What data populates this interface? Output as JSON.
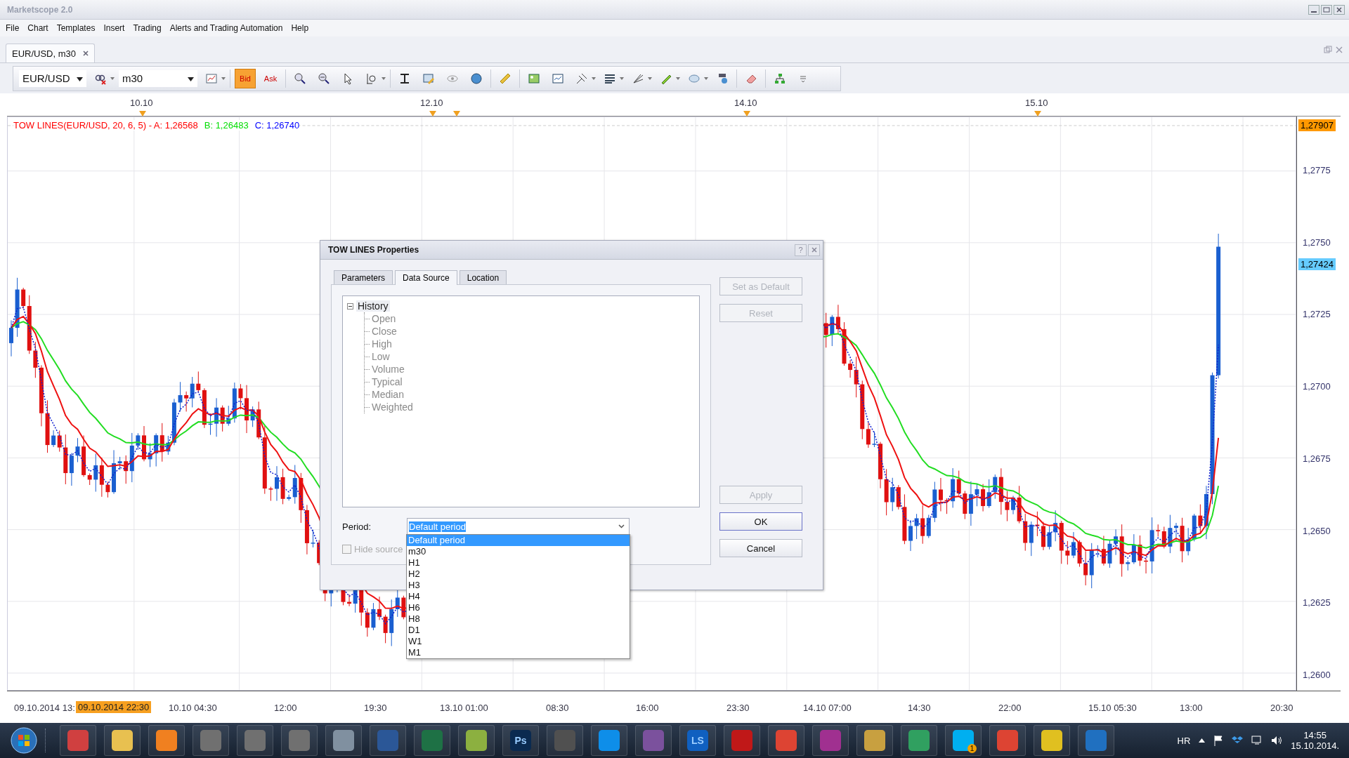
{
  "window": {
    "title": "Marketscope 2.0"
  },
  "menu": [
    "File",
    "Chart",
    "Templates",
    "Insert",
    "Trading",
    "Alerts and Trading Automation",
    "Help"
  ],
  "tabs": [
    {
      "label": "EUR/USD, m30",
      "selected": true
    }
  ],
  "toolbar": {
    "instrument": "EUR/USD",
    "timeframe": "m30",
    "price_modes": [
      {
        "label": "Bid",
        "selected": true
      },
      {
        "label": "Ask",
        "selected": false
      }
    ]
  },
  "chart": {
    "date_labels": [
      "10.10",
      "12.10",
      "14.10",
      "15.10"
    ],
    "legend": [
      {
        "text": "TOW LINES(EUR/USD, 20, 6, 5) -  A: 1,26568",
        "color": "#ff0000"
      },
      {
        "text": "B: 1,26483",
        "color": "#00dd00"
      },
      {
        "text": "C: 1,26740",
        "color": "#0000ff"
      }
    ],
    "price_labels": [
      "1,2775",
      "1,2750",
      "1,2725",
      "1,2700",
      "1,2675",
      "1,2650",
      "1,2625",
      "1,2600"
    ],
    "price_markers": [
      {
        "text": "1,27907",
        "color": "#ff9900"
      },
      {
        "text": "1,27424",
        "color": "#66ccff"
      }
    ],
    "time_labels": [
      "09.10.2014 13:",
      "10.10 04:30",
      "12:00",
      "19:30",
      "13.10 01:00",
      "08:30",
      "16:00",
      "23:30",
      "14.10 07:00",
      "14:30",
      "22:00",
      "15.10 05:30",
      "13:00",
      "20:30"
    ],
    "cursor_time": "09.10.2014 22:30"
  },
  "dialog": {
    "title": "TOW LINES Properties",
    "help": "?",
    "tabs": [
      {
        "label": "Parameters",
        "selected": false
      },
      {
        "label": "Data Source",
        "selected": true
      },
      {
        "label": "Location",
        "selected": false
      }
    ],
    "tree": [
      {
        "label": "History",
        "expanded": true,
        "disabled": false,
        "children": [
          {
            "label": "Open",
            "disabled": true
          },
          {
            "label": "Close",
            "disabled": true
          },
          {
            "label": "High",
            "disabled": true
          },
          {
            "label": "Low",
            "disabled": true
          },
          {
            "label": "Volume",
            "disabled": true
          },
          {
            "label": "Typical",
            "disabled": true
          },
          {
            "label": "Median",
            "disabled": true
          },
          {
            "label": "Weighted",
            "disabled": true
          }
        ]
      }
    ],
    "period": {
      "label": "Period:",
      "value": "Default period",
      "expanded": true,
      "options": [
        {
          "label": "Default period",
          "selected": true
        },
        {
          "label": "m30",
          "selected": false
        },
        {
          "label": "H1",
          "selected": false
        },
        {
          "label": "H2",
          "selected": false
        },
        {
          "label": "H3",
          "selected": false
        },
        {
          "label": "H4",
          "selected": false
        },
        {
          "label": "H6",
          "selected": false
        },
        {
          "label": "H8",
          "selected": false
        },
        {
          "label": "D1",
          "selected": false
        },
        {
          "label": "W1",
          "selected": false
        },
        {
          "label": "M1",
          "selected": false
        }
      ]
    },
    "hide_source": {
      "label": "Hide source",
      "checked": false,
      "disabled": true
    },
    "side_buttons": [
      {
        "label": "Set as Default",
        "disabled": true,
        "focused": false
      },
      {
        "label": "Reset",
        "disabled": true,
        "focused": false
      }
    ],
    "action_buttons": [
      {
        "label": "Apply",
        "disabled": true,
        "focused": false
      },
      {
        "label": "OK",
        "disabled": false,
        "focused": true
      },
      {
        "label": "Cancel",
        "disabled": false,
        "focused": false
      }
    ]
  },
  "taskbar": {
    "apps": [
      {
        "color": "#d04040"
      },
      {
        "color": "#e8c050"
      },
      {
        "color": "#f08020"
      },
      {
        "color": "#707070"
      },
      {
        "color": "#707070"
      },
      {
        "color": "#707070"
      },
      {
        "color": "#8090a0"
      },
      {
        "color": "#2b5797"
      },
      {
        "color": "#1e7145"
      },
      {
        "color": "#8cb040"
      },
      {
        "color": "#0a2a50",
        "label": "Ps"
      },
      {
        "color": "#505050"
      },
      {
        "color": "#0e8ee9"
      },
      {
        "color": "#7b519d"
      },
      {
        "color": "#1060c0",
        "label": "LS"
      },
      {
        "color": "#c01818"
      },
      {
        "color": "#dd4433"
      },
      {
        "color": "#a03090"
      },
      {
        "color": "#c8a040"
      },
      {
        "color": "#30a060"
      },
      {
        "color": "#00aff0",
        "badge": "1"
      },
      {
        "color": "#dd4433"
      },
      {
        "color": "#e0c020"
      },
      {
        "color": "#2070c0"
      }
    ],
    "language": "HR",
    "time": "14:55",
    "date": "15.10.2014."
  }
}
